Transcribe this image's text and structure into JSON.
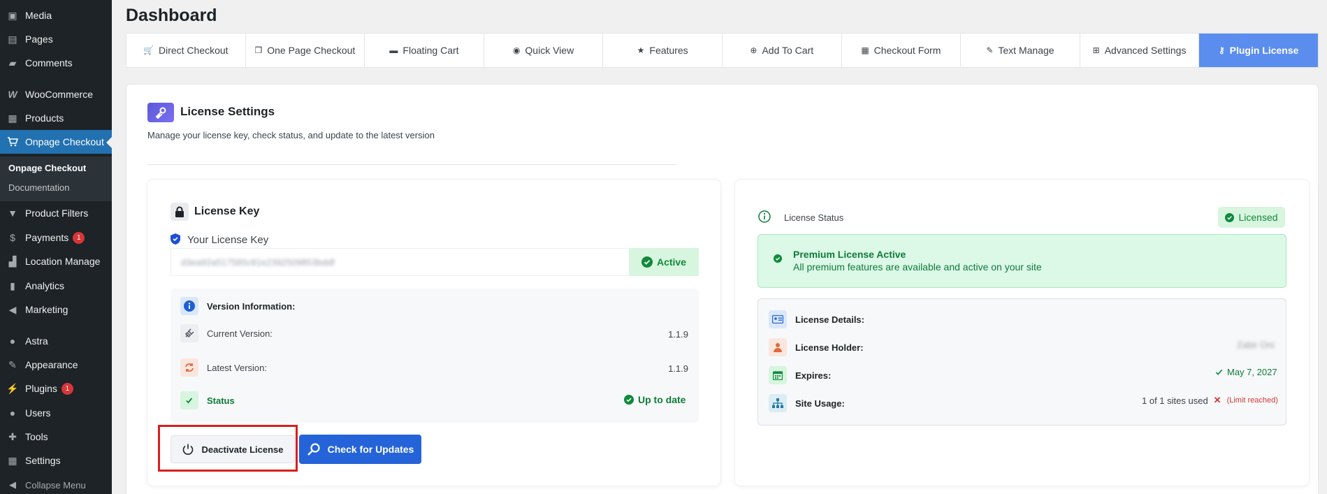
{
  "sidebar": {
    "items": [
      {
        "label": "Media",
        "icon": "media-icon"
      },
      {
        "label": "Pages",
        "icon": "pages-icon"
      },
      {
        "label": "Comments",
        "icon": "comments-icon"
      },
      {
        "label": "WooCommerce",
        "icon": "woocommerce-icon"
      },
      {
        "label": "Products",
        "icon": "products-icon"
      },
      {
        "label": "Onpage Checkout",
        "icon": "cart-icon"
      },
      {
        "label": "Product Filters",
        "icon": "filter-icon"
      },
      {
        "label": "Payments",
        "icon": "payments-icon",
        "badge": "1"
      },
      {
        "label": "Location Manage",
        "icon": "location-icon"
      },
      {
        "label": "Analytics",
        "icon": "analytics-icon"
      },
      {
        "label": "Marketing",
        "icon": "marketing-icon"
      },
      {
        "label": "Astra",
        "icon": "astra-icon"
      },
      {
        "label": "Appearance",
        "icon": "appearance-icon"
      },
      {
        "label": "Plugins",
        "icon": "plugins-icon",
        "badge": "1"
      },
      {
        "label": "Users",
        "icon": "users-icon"
      },
      {
        "label": "Tools",
        "icon": "tools-icon"
      },
      {
        "label": "Settings",
        "icon": "settings-icon"
      }
    ],
    "submenu": [
      "Onpage Checkout",
      "Documentation"
    ],
    "collapse": "Collapse Menu"
  },
  "page": {
    "title": "Dashboard"
  },
  "tabs": [
    {
      "label": "Direct Checkout",
      "icon": "cart-icon"
    },
    {
      "label": "One Page Checkout",
      "icon": "copy-icon"
    },
    {
      "label": "Floating Cart",
      "icon": "window-icon"
    },
    {
      "label": "Quick View",
      "icon": "eye-icon"
    },
    {
      "label": "Features",
      "icon": "star-icon"
    },
    {
      "label": "Add To Cart",
      "icon": "plus-circle-icon"
    },
    {
      "label": "Checkout Form",
      "icon": "form-icon"
    },
    {
      "label": "Text Manage",
      "icon": "pencil-icon"
    },
    {
      "label": "Advanced Settings",
      "icon": "grid-icon"
    },
    {
      "label": "Plugin License",
      "icon": "key-icon"
    }
  ],
  "license": {
    "title": "License Settings",
    "subtitle": "Manage your license key, check status, and update to the latest version",
    "key_section": "License Key",
    "key_label": "Your License Key",
    "key_value": "d3ea92a517585c81e2392509853bddf",
    "key_status": "Active",
    "version_title": "Version Information:",
    "current_label": "Current Version:",
    "current_value": "1.1.9",
    "latest_label": "Latest Version:",
    "latest_value": "1.1.9",
    "status_label": "Status",
    "status_value": "Up to date",
    "deactivate_label": "Deactivate License",
    "check_label": "Check for Updates"
  },
  "status": {
    "label": "License Status",
    "badge": "Licensed",
    "premium_title": "Premium License Active",
    "premium_sub": "All premium features are available and active on your site",
    "details_label": "License Details:",
    "holder_label": "License Holder:",
    "holder_value": "Zabir Oni",
    "expires_label": "Expires:",
    "expires_value": "May 7, 2027",
    "usage_label": "Site Usage:",
    "usage_value": "1 of 1 sites used",
    "usage_note": "(Limit reached)"
  }
}
